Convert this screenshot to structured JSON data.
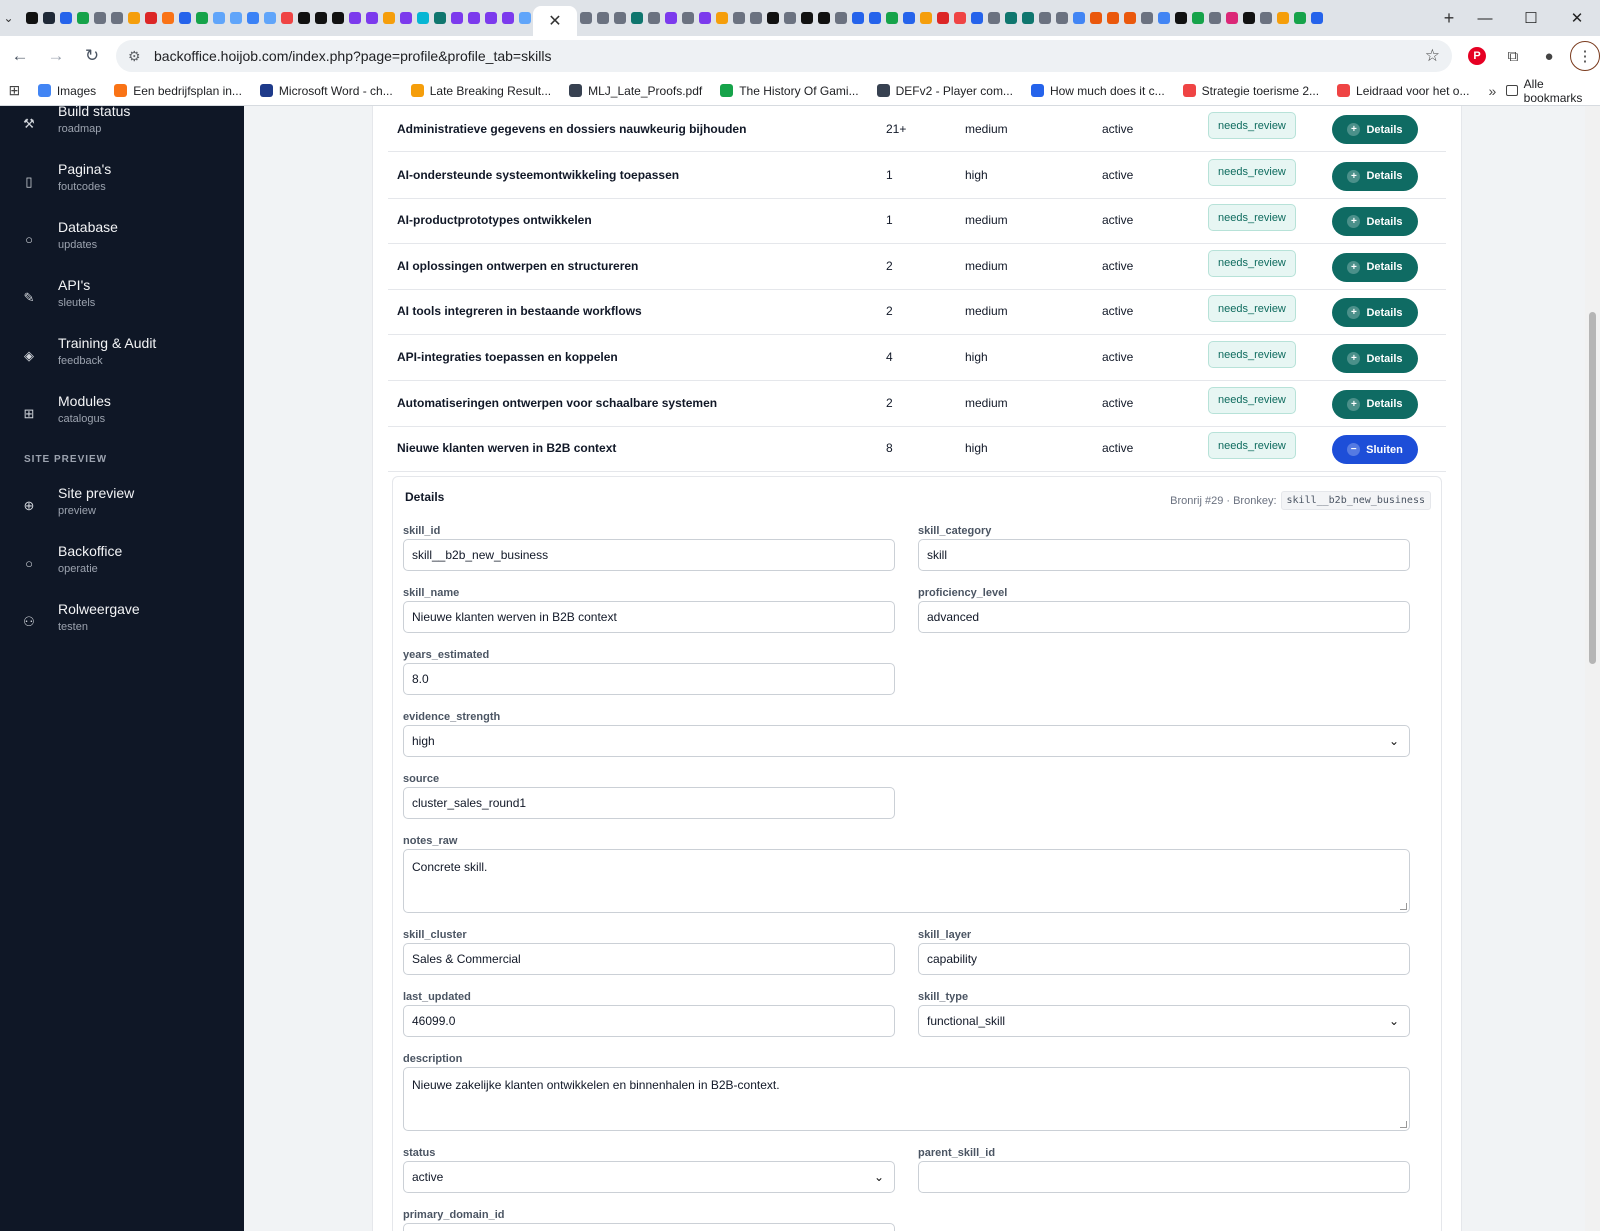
{
  "browser": {
    "url": "backoffice.hoijob.com/index.php?page=profile&profile_tab=skills",
    "new_tab_label": "+",
    "bookmarks": [
      {
        "label": "Images",
        "color": "#4285f4"
      },
      {
        "label": "Een bedrijfsplan in...",
        "color": "#f97316"
      },
      {
        "label": "Microsoft Word - ch...",
        "color": "#1e3a8a"
      },
      {
        "label": "Late Breaking Result...",
        "color": "#f59e0b"
      },
      {
        "label": "MLJ_Late_Proofs.pdf",
        "color": "#374151"
      },
      {
        "label": "The History Of Gami...",
        "color": "#16a34a"
      },
      {
        "label": "DEFv2 - Player com...",
        "color": "#374151"
      },
      {
        "label": "How much does it c...",
        "color": "#2563eb"
      },
      {
        "label": "Strategie toerisme 2...",
        "color": "#ef4444"
      },
      {
        "label": "Leidraad voor het o...",
        "color": "#ef4444"
      }
    ],
    "all_bookmarks_label": "Alle bookmarks"
  },
  "sidebar": {
    "items": [
      {
        "label": "Build status",
        "sub": "roadmap",
        "icon": "wrench-icon"
      },
      {
        "label": "Pagina's",
        "sub": "foutcodes",
        "icon": "file-icon"
      },
      {
        "label": "Database",
        "sub": "updates",
        "icon": "circle-icon"
      },
      {
        "label": "API's",
        "sub": "sleutels",
        "icon": "pen-icon"
      },
      {
        "label": "Training & Audit",
        "sub": "feedback",
        "icon": "graduation-cap-icon"
      },
      {
        "label": "Modules",
        "sub": "catalogus",
        "icon": "grid-icon"
      }
    ],
    "section_title": "SITE PREVIEW",
    "section_items": [
      {
        "label": "Site preview",
        "sub": "preview",
        "icon": "globe-icon"
      },
      {
        "label": "Backoffice",
        "sub": "operatie",
        "icon": "circle-icon"
      },
      {
        "label": "Rolweergave",
        "sub": "testen",
        "icon": "users-icon"
      }
    ]
  },
  "skills": {
    "rows": [
      {
        "name": "Administratieve gegevens en dossiers nauwkeurig bijhouden",
        "count": "21+",
        "level": "medium",
        "status": "active",
        "review": "needs_review",
        "action": "Details"
      },
      {
        "name": "AI-ondersteunde systeemontwikkeling toepassen",
        "count": "1",
        "level": "high",
        "status": "active",
        "review": "needs_review",
        "action": "Details"
      },
      {
        "name": "AI-productprototypes ontwikkelen",
        "count": "1",
        "level": "medium",
        "status": "active",
        "review": "needs_review",
        "action": "Details"
      },
      {
        "name": "AI oplossingen ontwerpen en structureren",
        "count": "2",
        "level": "medium",
        "status": "active",
        "review": "needs_review",
        "action": "Details"
      },
      {
        "name": "AI tools integreren in bestaande workflows",
        "count": "2",
        "level": "medium",
        "status": "active",
        "review": "needs_review",
        "action": "Details"
      },
      {
        "name": "API-integraties toepassen en koppelen",
        "count": "4",
        "level": "high",
        "status": "active",
        "review": "needs_review",
        "action": "Details"
      },
      {
        "name": "Automatiseringen ontwerpen voor schaalbare systemen",
        "count": "2",
        "level": "medium",
        "status": "active",
        "review": "needs_review",
        "action": "Details"
      },
      {
        "name": "Nieuwe klanten werven in B2B context",
        "count": "8",
        "level": "high",
        "status": "active",
        "review": "needs_review",
        "action": "Sluiten"
      }
    ]
  },
  "details": {
    "title": "Details",
    "meta_prefix": "Bronrij #29 · Bronkey:",
    "meta_key": "skill__b2b_new_business",
    "fields": {
      "skill_id": {
        "label": "skill_id",
        "value": "skill__b2b_new_business"
      },
      "skill_category": {
        "label": "skill_category",
        "value": "skill"
      },
      "skill_name": {
        "label": "skill_name",
        "value": "Nieuwe klanten werven in B2B context"
      },
      "proficiency_level": {
        "label": "proficiency_level",
        "value": "advanced"
      },
      "years_estimated": {
        "label": "years_estimated",
        "value": "8.0"
      },
      "evidence_strength": {
        "label": "evidence_strength",
        "value": "high"
      },
      "source": {
        "label": "source",
        "value": "cluster_sales_round1"
      },
      "notes_raw": {
        "label": "notes_raw",
        "value": "Concrete skill."
      },
      "skill_cluster": {
        "label": "skill_cluster",
        "value": "Sales & Commercial"
      },
      "skill_layer": {
        "label": "skill_layer",
        "value": "capability"
      },
      "last_updated": {
        "label": "last_updated",
        "value": "46099.0"
      },
      "skill_type": {
        "label": "skill_type",
        "value": "functional_skill"
      },
      "description": {
        "label": "description",
        "value": "Nieuwe zakelijke klanten ontwikkelen en binnenhalen in B2B-context."
      },
      "status": {
        "label": "status",
        "value": "active"
      },
      "parent_skill_id": {
        "label": "parent_skill_id",
        "value": ""
      },
      "primary_domain_id": {
        "label": "primary_domain_id",
        "value": ""
      }
    }
  }
}
